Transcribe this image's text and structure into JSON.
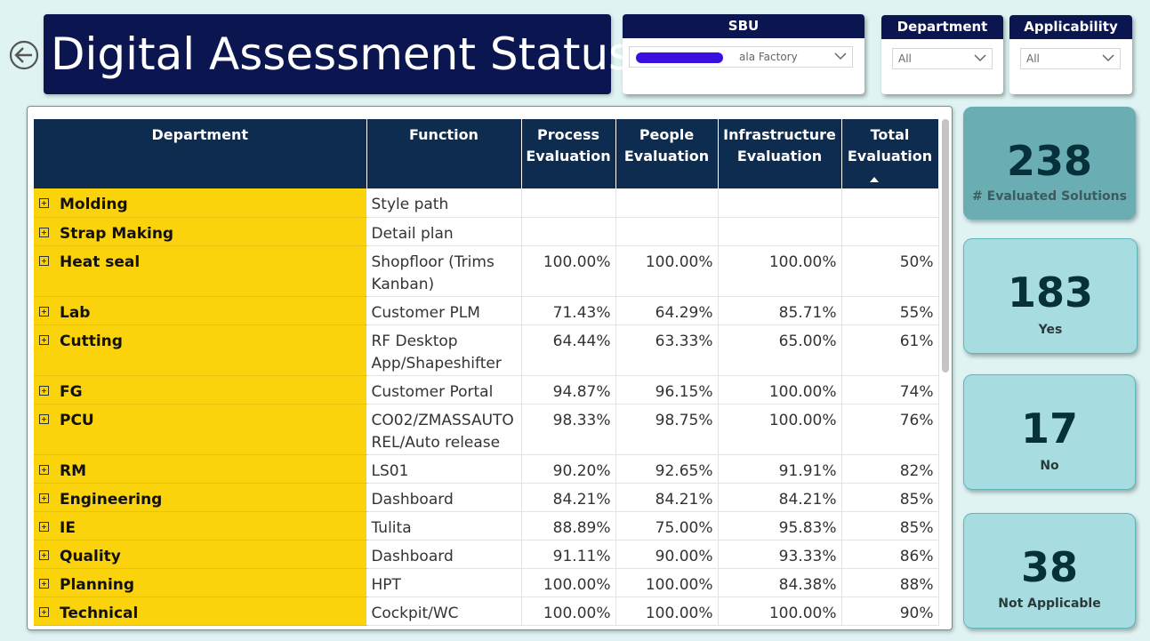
{
  "title": "Digital Assessment Status",
  "slicers": {
    "sbu": {
      "label": "SBU",
      "value": "ala Factory"
    },
    "department": {
      "label": "Department",
      "value": "All"
    },
    "applicability": {
      "label": "Applicability",
      "value": "All"
    }
  },
  "table": {
    "headers": [
      "Department",
      "Function",
      "Process Evaluation",
      "People Evaluation",
      "Infrastructure Evaluation",
      "Total Evaluation"
    ],
    "sorted_column": "Total Evaluation",
    "rows": [
      {
        "department": "Molding",
        "function": "Style path",
        "process": "",
        "people": "",
        "infra": "",
        "total": ""
      },
      {
        "department": "Strap Making",
        "function": "Detail plan",
        "process": "",
        "people": "",
        "infra": "",
        "total": ""
      },
      {
        "department": "Heat seal",
        "function": "Shopfloor (Trims Kanban)",
        "process": "100.00%",
        "people": "100.00%",
        "infra": "100.00%",
        "total": "50%"
      },
      {
        "department": "Lab",
        "function": "Customer PLM",
        "process": "71.43%",
        "people": "64.29%",
        "infra": "85.71%",
        "total": "55%"
      },
      {
        "department": "Cutting",
        "function": "RF Desktop App/Shapeshifter",
        "process": "64.44%",
        "people": "63.33%",
        "infra": "65.00%",
        "total": "61%"
      },
      {
        "department": "FG",
        "function": "Customer Portal",
        "process": "94.87%",
        "people": "96.15%",
        "infra": "100.00%",
        "total": "74%"
      },
      {
        "department": "PCU",
        "function": "CO02/ZMASSAUTO REL/Auto release",
        "process": "98.33%",
        "people": "98.75%",
        "infra": "100.00%",
        "total": "76%"
      },
      {
        "department": "RM",
        "function": "LS01",
        "process": "90.20%",
        "people": "92.65%",
        "infra": "91.91%",
        "total": "82%"
      },
      {
        "department": "Engineering",
        "function": "Dashboard",
        "process": "84.21%",
        "people": "84.21%",
        "infra": "84.21%",
        "total": "85%"
      },
      {
        "department": "IE",
        "function": "Tulita",
        "process": "88.89%",
        "people": "75.00%",
        "infra": "95.83%",
        "total": "85%"
      },
      {
        "department": "Quality",
        "function": "Dashboard",
        "process": "91.11%",
        "people": "90.00%",
        "infra": "93.33%",
        "total": "86%"
      },
      {
        "department": "Planning",
        "function": "HPT",
        "process": "100.00%",
        "people": "100.00%",
        "infra": "84.38%",
        "total": "88%"
      },
      {
        "department": "Technical",
        "function": "Cockpit/WC",
        "process": "100.00%",
        "people": "100.00%",
        "infra": "100.00%",
        "total": "90%"
      }
    ]
  },
  "cards": [
    {
      "value": "238",
      "label": "# Evaluated Solutions"
    },
    {
      "value": "183",
      "label": "Yes"
    },
    {
      "value": "17",
      "label": "No"
    },
    {
      "value": "38",
      "label": "Not Applicable"
    }
  ],
  "icons": {
    "back": "back-arrow-icon",
    "chevron": "chevron-down-icon",
    "expand": "expand-plus-icon",
    "sort": "sort-ascending-icon"
  },
  "colors": {
    "title_bg": "#0b1550",
    "header_bg": "#0d2c4f",
    "department_bg": "#fad30c",
    "card_bg": "#a7dde0",
    "card_highlight_bg": "#6aaeb3",
    "page_bg": "#dff3f3"
  }
}
